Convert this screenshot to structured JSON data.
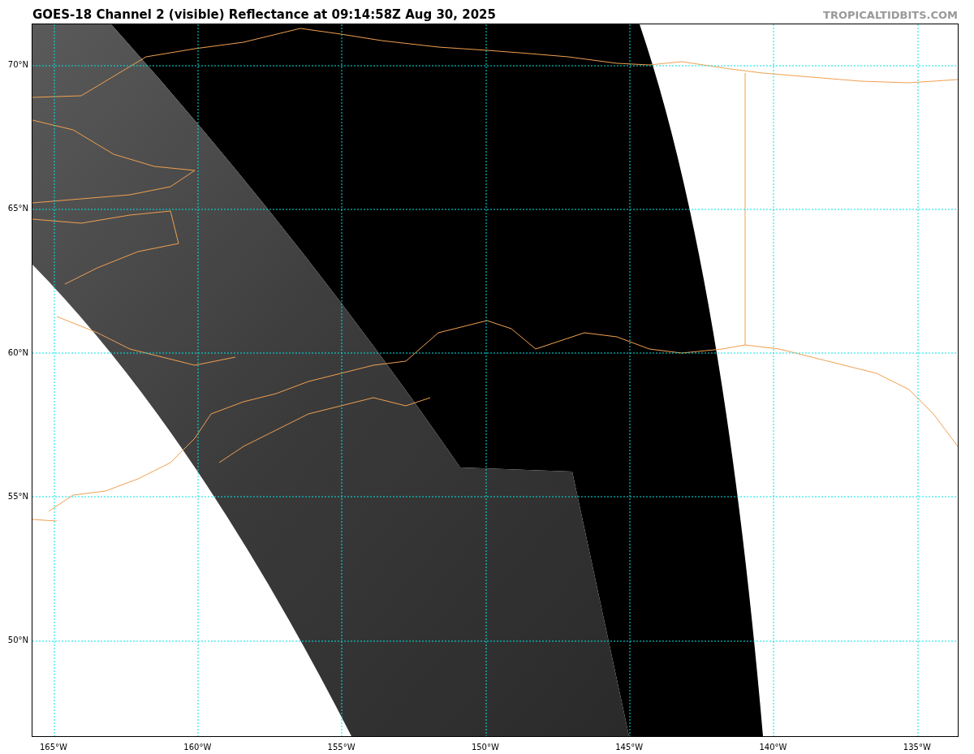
{
  "title": "GOES-18 Channel 2 (visible) Reflectance at 09:14:58Z Aug 30, 2025",
  "brand": "TROPICALTIDBITS.COM",
  "map": {
    "lat_ticks": [
      "70°N",
      "65°N",
      "60°N",
      "55°N",
      "50°N"
    ],
    "lon_ticks": [
      "165°W",
      "160°W",
      "155°W",
      "150°W",
      "145°W",
      "140°W",
      "135°W"
    ]
  }
}
